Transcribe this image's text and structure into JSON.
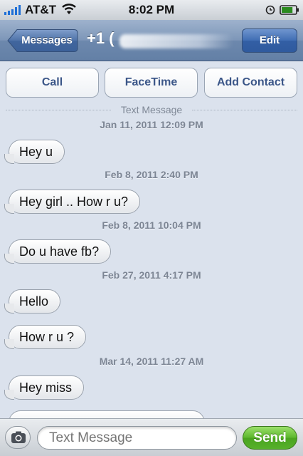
{
  "status_bar": {
    "carrier": "AT&T",
    "time": "8:02 PM",
    "signal_bars": 5,
    "battery_level": 0.8
  },
  "nav_bar": {
    "back_label": "Messages",
    "title": "+1 (",
    "edit_label": "Edit"
  },
  "actions": {
    "call": "Call",
    "facetime": "FaceTime",
    "add_contact": "Add Contact"
  },
  "thread": {
    "header": "Text Message",
    "timestamps": [
      "Jan 11, 2011 12:09 PM",
      "Feb 8, 2011 2:40 PM",
      "Feb 8, 2011 10:04 PM",
      "Feb 27, 2011 4:17 PM",
      "Mar 14, 2011 11:27 AM"
    ],
    "messages": [
      "Hey u",
      "Hey girl .. How r u?",
      "Do u have fb?",
      "Hello",
      "How r u ?",
      "Hey miss"
    ]
  },
  "input_bar": {
    "placeholder": "Text Message",
    "send_label": "Send"
  },
  "colors": {
    "thread_background": "#dbe2ed",
    "nav_bar": "#7d96b8",
    "send_green": "#5bb62c",
    "link_blue": "#3b5688"
  }
}
